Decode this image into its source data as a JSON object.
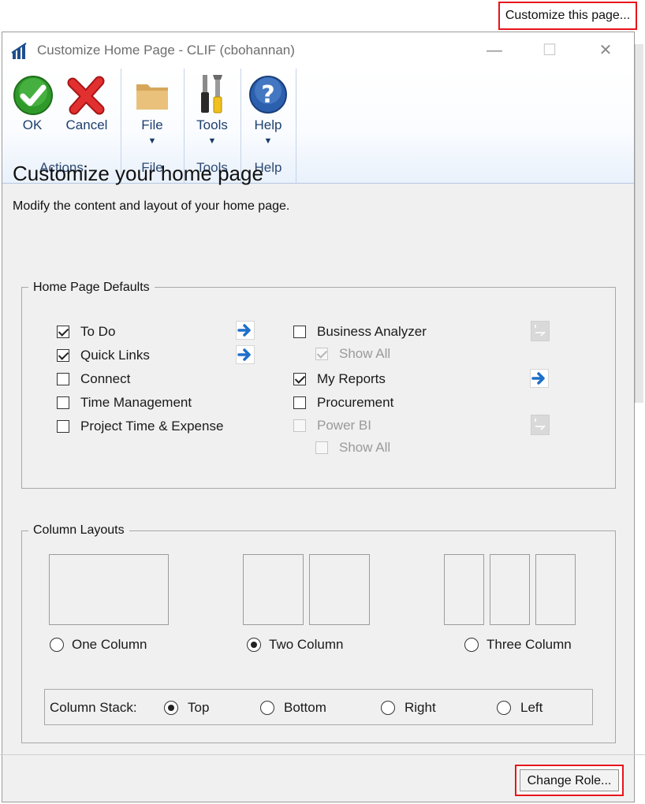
{
  "top_link": "Customize this page...",
  "window": {
    "title": "Customize Home Page  -  CLIF (cbohannan)",
    "controls": {
      "minimize": "—",
      "maximize": "☐",
      "close": "✕"
    }
  },
  "ribbon": {
    "groups": [
      {
        "label": "Actions",
        "buttons": [
          {
            "label": "OK",
            "icon": "ok-check-icon"
          },
          {
            "label": "Cancel",
            "icon": "cancel-x-icon"
          }
        ]
      },
      {
        "label": "File",
        "buttons": [
          {
            "label": "File",
            "icon": "folder-icon"
          }
        ]
      },
      {
        "label": "Tools",
        "buttons": [
          {
            "label": "Tools",
            "icon": "tools-icon"
          }
        ]
      },
      {
        "label": "Help",
        "buttons": [
          {
            "label": "Help",
            "icon": "help-icon"
          }
        ]
      }
    ],
    "caret": "▼"
  },
  "heading": "Customize your home page",
  "subtext": "Modify the content and layout of your home page.",
  "defaults": {
    "title": "Home Page Defaults",
    "left": [
      {
        "label": "To Do",
        "checked": true
      },
      {
        "label": "Quick Links",
        "checked": true
      },
      {
        "label": "Connect",
        "checked": false
      },
      {
        "label": "Time Management",
        "checked": false
      },
      {
        "label": "Project Time & Expense",
        "checked": false
      }
    ],
    "right": [
      {
        "label": "Business Analyzer",
        "checked": false
      },
      {
        "label": "Show All",
        "checked": true,
        "disabled": true
      },
      {
        "label": "My Reports",
        "checked": true
      },
      {
        "label": "Procurement",
        "checked": false
      },
      {
        "label": "Power BI",
        "checked": false,
        "disabled": true
      },
      {
        "label": "Show All",
        "checked": false,
        "disabled": true
      }
    ]
  },
  "layouts": {
    "title": "Column Layouts",
    "options": [
      {
        "label": "One Column",
        "selected": false
      },
      {
        "label": "Two Column",
        "selected": true
      },
      {
        "label": "Three Column",
        "selected": false
      }
    ],
    "stack": {
      "label": "Column Stack:",
      "options": [
        {
          "label": "Top",
          "selected": true
        },
        {
          "label": "Bottom",
          "selected": false
        },
        {
          "label": "Right",
          "selected": false
        },
        {
          "label": "Left",
          "selected": false
        }
      ]
    }
  },
  "change_role": "Change Role..."
}
